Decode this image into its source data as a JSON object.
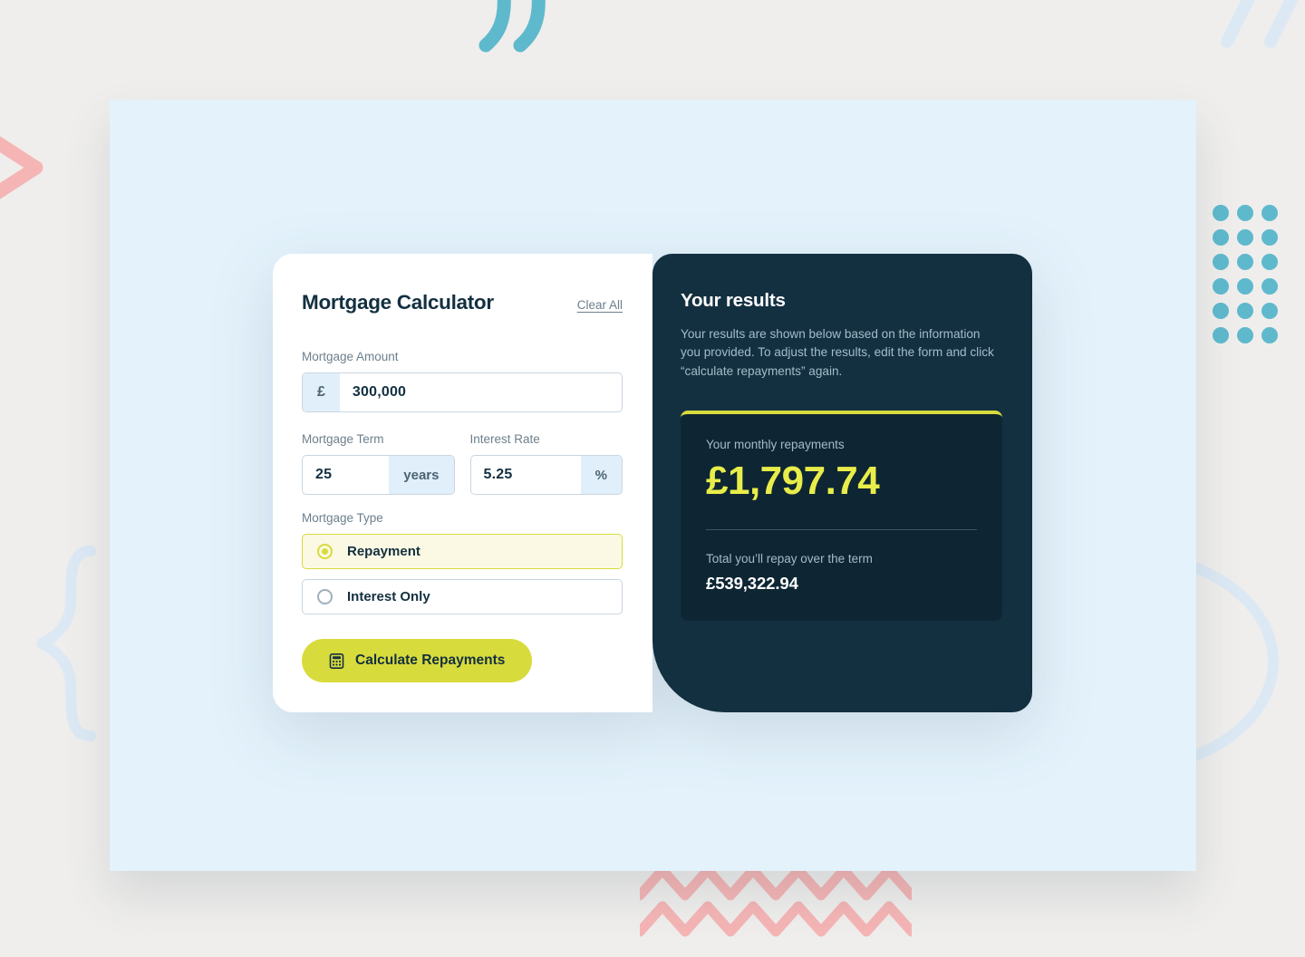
{
  "decorations": {
    "quote_icon": "double-quote-mark",
    "slashes_icon": "double-slash",
    "chevron_icon": "right-chevron",
    "brace_icon": "curly-brace",
    "circle_icon": "outline-circle",
    "zigzag_icon": "zigzag-lines",
    "dot_grid_icon": "dot-grid",
    "dot_grid_columns": 3,
    "dot_grid_rows": 6,
    "colors": {
      "teal": "#5fb9cd",
      "pink": "#f5b5b5",
      "pale_blue": "#dce9f5",
      "page_background": "#efeeec",
      "stage_background": "#e3f2fb"
    }
  },
  "calculator": {
    "title": "Mortgage Calculator",
    "clear_label": "Clear All",
    "amount": {
      "label": "Mortgage Amount",
      "prefix": "£",
      "value": "300,000",
      "placeholder": "300,000"
    },
    "term": {
      "label": "Mortgage Term",
      "value": "25",
      "suffix": "years",
      "placeholder": "25"
    },
    "rate": {
      "label": "Interest Rate",
      "value": "5.25",
      "suffix": "%",
      "placeholder": "5.25"
    },
    "type": {
      "label": "Mortgage Type",
      "options": [
        {
          "label": "Repayment",
          "selected": true
        },
        {
          "label": "Interest Only",
          "selected": false
        }
      ]
    },
    "submit": {
      "label": "Calculate Repayments",
      "icon": "calculator-icon"
    },
    "accent_color": "#d8db3c"
  },
  "results": {
    "title": "Your results",
    "description": "Your results are shown below based on the information you provided. To adjust the results, edit the form and click “calculate repayments” again.",
    "monthly_caption": "Your monthly repayments",
    "monthly_value": "£1,797.74",
    "total_caption": "Total you’ll repay over the term",
    "total_value": "£539,322.94",
    "panel_color": "#133040",
    "highlight_color": "#e8ed4a"
  }
}
